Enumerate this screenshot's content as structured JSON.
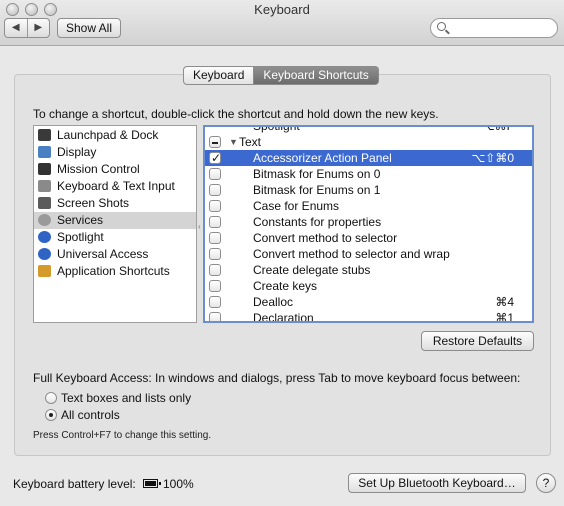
{
  "window": {
    "title": "Keyboard",
    "back_label": "◀",
    "forward_label": "▶",
    "show_all": "Show All",
    "search_placeholder": ""
  },
  "tabs": [
    {
      "label": "Keyboard",
      "active": false
    },
    {
      "label": "Keyboard Shortcuts",
      "active": true
    }
  ],
  "instructions": "To change a shortcut, double-click the shortcut and hold down the new keys.",
  "categories": [
    {
      "label": "Launchpad & Dock",
      "icon": "launchpad-icon",
      "color": "#3a3a3a",
      "selected": false
    },
    {
      "label": "Display",
      "icon": "display-icon",
      "color": "#4a7fc1",
      "selected": false
    },
    {
      "label": "Mission Control",
      "icon": "mission-control-icon",
      "color": "#333333",
      "selected": false
    },
    {
      "label": "Keyboard & Text Input",
      "icon": "keyboard-icon",
      "color": "#8a8a8a",
      "selected": false
    },
    {
      "label": "Screen Shots",
      "icon": "camera-icon",
      "color": "#5a5a5a",
      "selected": false
    },
    {
      "label": "Services",
      "icon": "gear-icon",
      "color": "#9a9a9a",
      "selected": true
    },
    {
      "label": "Spotlight",
      "icon": "spotlight-icon",
      "color": "#2f64c4",
      "selected": false
    },
    {
      "label": "Universal Access",
      "icon": "universal-access-icon",
      "color": "#2f64c4",
      "selected": false
    },
    {
      "label": "Application Shortcuts",
      "icon": "app-shortcuts-icon",
      "color": "#d49a2a",
      "selected": false
    }
  ],
  "shortcuts": {
    "partial_top": {
      "label": "Spotlight",
      "key": "⌥⌘F"
    },
    "group": {
      "label": "Text",
      "disclosure": "▼"
    },
    "items": [
      {
        "label": "Accessorizer Action Panel",
        "key": "⌥⇧⌘0",
        "checked": true,
        "selected": true
      },
      {
        "label": "Bitmask for Enums on 0",
        "key": "",
        "checked": false,
        "selected": false
      },
      {
        "label": "Bitmask for Enums on 1",
        "key": "",
        "checked": false,
        "selected": false
      },
      {
        "label": "Case for Enums",
        "key": "",
        "checked": false,
        "selected": false
      },
      {
        "label": "Constants for properties",
        "key": "",
        "checked": false,
        "selected": false
      },
      {
        "label": "Convert method to selector",
        "key": "",
        "checked": false,
        "selected": false
      },
      {
        "label": "Convert method to selector and wrap",
        "key": "",
        "checked": false,
        "selected": false
      },
      {
        "label": "Create delegate stubs",
        "key": "",
        "checked": false,
        "selected": false
      },
      {
        "label": "Create keys",
        "key": "",
        "checked": false,
        "selected": false
      },
      {
        "label": "Dealloc",
        "key": "⌘4",
        "checked": false,
        "selected": false
      },
      {
        "label": "Declaration",
        "key": "⌘1",
        "checked": false,
        "selected": false
      }
    ]
  },
  "restore_defaults": "Restore Defaults",
  "full_keyboard_access": {
    "label": "Full Keyboard Access: In windows and dialogs, press Tab to move keyboard focus between:",
    "options": [
      {
        "label": "Text boxes and lists only",
        "selected": false
      },
      {
        "label": "All controls",
        "selected": true
      }
    ],
    "hint": "Press Control+F7 to change this setting."
  },
  "battery": {
    "label": "Keyboard battery level:",
    "value": "100%",
    "level": 1.0
  },
  "bluetooth_button": "Set Up Bluetooth Keyboard…",
  "help": "?",
  "colors": {
    "selection": "#3b69d0",
    "focus_ring": "#6a8fcf"
  }
}
